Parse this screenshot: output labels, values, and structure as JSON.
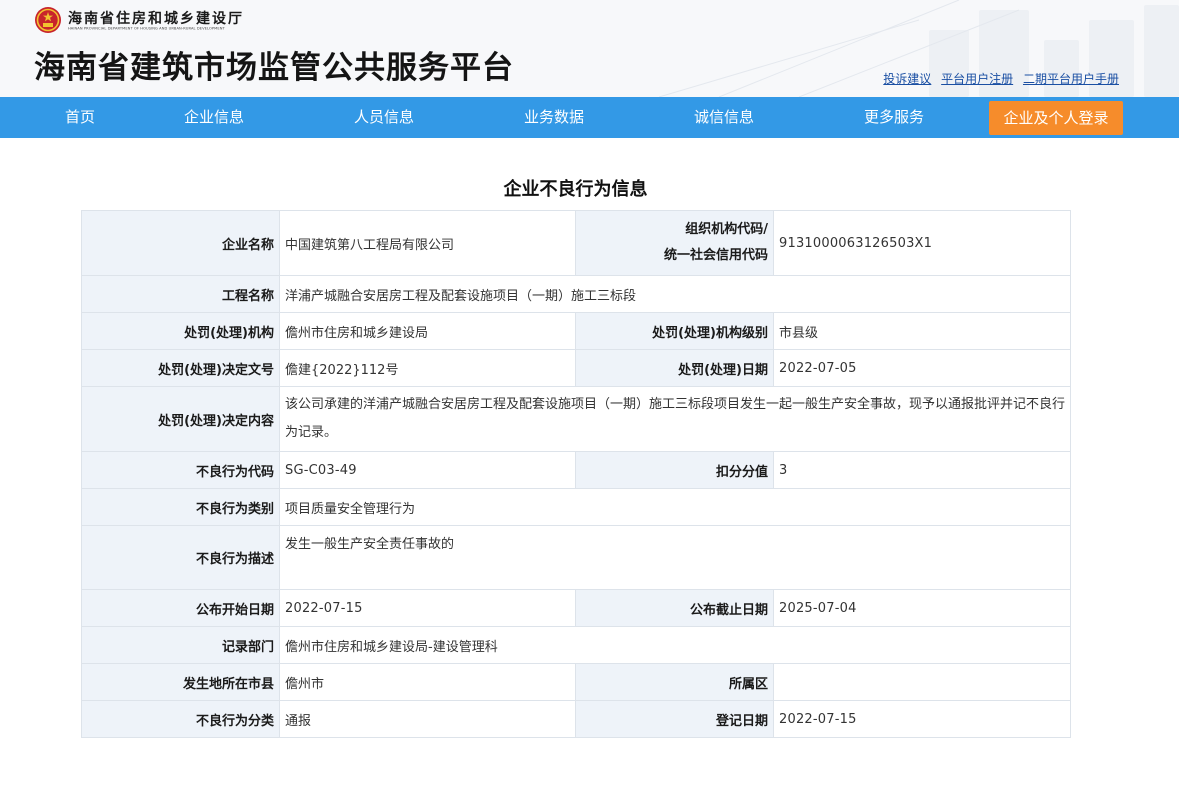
{
  "header": {
    "dept_cn": "海南省住房和城乡建设厅",
    "dept_en": "HAINAN PROVINCIAL DEPARTMENT OF HOUSING AND URBAN-RURAL DEVELOPMENT",
    "site_title": "海南省建筑市场监管公共服务平台",
    "links": [
      "投诉建议",
      "平台用户注册",
      "二期平台用户手册"
    ]
  },
  "nav": {
    "items": [
      "首页",
      "企业信息",
      "人员信息",
      "业务数据",
      "诚信信息",
      "更多服务"
    ],
    "login": "企业及个人登录"
  },
  "page_title": "企业不良行为信息",
  "record": {
    "company_name_label": "企业名称",
    "company_name": "中国建筑第八工程局有限公司",
    "org_code_label_1": "组织机构代码/",
    "org_code_label_2": "统一社会信用代码",
    "org_code": "9131000063126503X1",
    "project_label": "工程名称",
    "project": "洋浦产城融合安居房工程及配套设施项目（一期）施工三标段",
    "authority_label": "处罚(处理)机构",
    "authority": "儋州市住房和城乡建设局",
    "authority_level_label": "处罚(处理)机构级别",
    "authority_level": "市县级",
    "decision_no_label": "处罚(处理)决定文号",
    "decision_no": "儋建{2022}112号",
    "decision_date_label": "处罚(处理)日期",
    "decision_date": "2022-07-05",
    "decision_content_label": "处罚(处理)决定内容",
    "decision_content": "该公司承建的洋浦产城融合安居房工程及配套设施项目（一期）施工三标段项目发生一起一般生产安全事故，现予以通报批评并记不良行为记录。",
    "code_label": "不良行为代码",
    "code": "SG-C03-49",
    "score_label": "扣分分值",
    "score": "3",
    "category_label": "不良行为类别",
    "category": "项目质量安全管理行为",
    "description_label": "不良行为描述",
    "description": "发生一般生产安全责任事故的",
    "publish_start_label": "公布开始日期",
    "publish_start": "2022-07-15",
    "publish_end_label": "公布截止日期",
    "publish_end": "2025-07-04",
    "department_label": "记录部门",
    "department": "儋州市住房和城乡建设局-建设管理科",
    "city_label": "发生地所在市县",
    "city": "儋州市",
    "district_label": "所属区",
    "district": "",
    "classification_label": "不良行为分类",
    "classification": "通报",
    "register_date_label": "登记日期",
    "register_date": "2022-07-15"
  }
}
